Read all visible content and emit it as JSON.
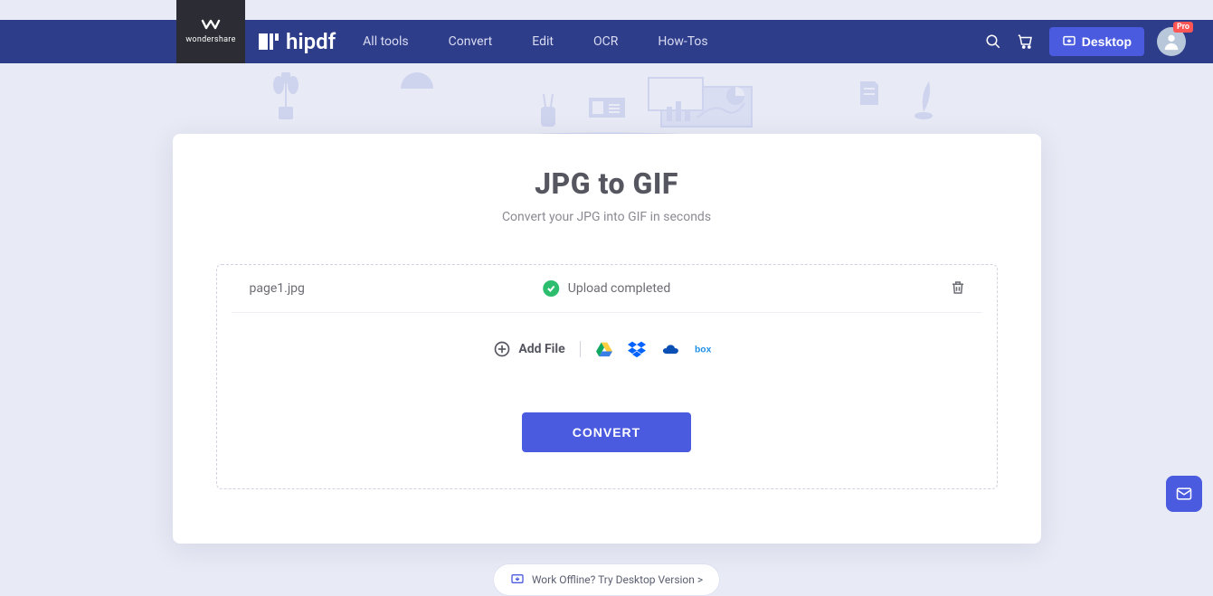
{
  "brand": {
    "parent": "wondershare",
    "product": "hipdf"
  },
  "nav": {
    "items": [
      "All tools",
      "Convert",
      "Edit",
      "OCR",
      "How-Tos"
    ],
    "desktop_label": "Desktop",
    "avatar_badge": "Pro"
  },
  "page": {
    "title": "JPG to GIF",
    "subtitle": "Convert your JPG into GIF in seconds"
  },
  "upload": {
    "file_name": "page1.jpg",
    "status_text": "Upload completed",
    "add_file_label": "Add File"
  },
  "actions": {
    "convert_label": "CONVERT",
    "offline_text": "Work Offline? Try Desktop Version >"
  }
}
